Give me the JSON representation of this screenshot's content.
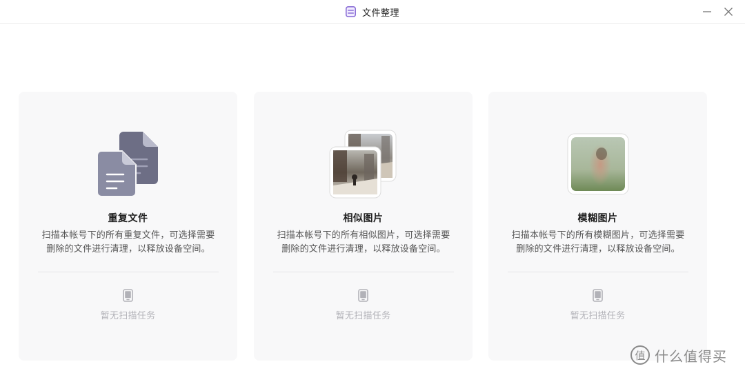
{
  "window": {
    "title": "文件整理",
    "minimize_icon": "minimize-icon",
    "close_icon": "close-icon"
  },
  "cards": [
    {
      "title": "重复文件",
      "description": "扫描本帐号下的所有重复文件，可选择需要删除的文件进行清理，以释放设备空间。",
      "empty_text": "暂无扫描任务",
      "illustration": "duplicate-files-icon"
    },
    {
      "title": "相似图片",
      "description": "扫描本帐号下的所有相似图片，可选择需要删除的文件进行清理，以释放设备空间。",
      "empty_text": "暂无扫描任务",
      "illustration": "similar-photos-thumbnails"
    },
    {
      "title": "模糊图片",
      "description": "扫描本帐号下的所有模糊图片，可选择需要删除的文件进行清理，以释放设备空间。",
      "empty_text": "暂无扫描任务",
      "illustration": "blurry-photo-thumbnail"
    }
  ],
  "watermark": {
    "text": "什么值得买",
    "icon": "smzdm-logo-icon"
  },
  "colors": {
    "card_bg": "#f8f8f9",
    "doc_icon_back": "#6d6e85",
    "doc_icon_front": "#8a8ca3",
    "app_icon_accent": "#8b6fd6",
    "empty_text": "#b2b2b8"
  }
}
